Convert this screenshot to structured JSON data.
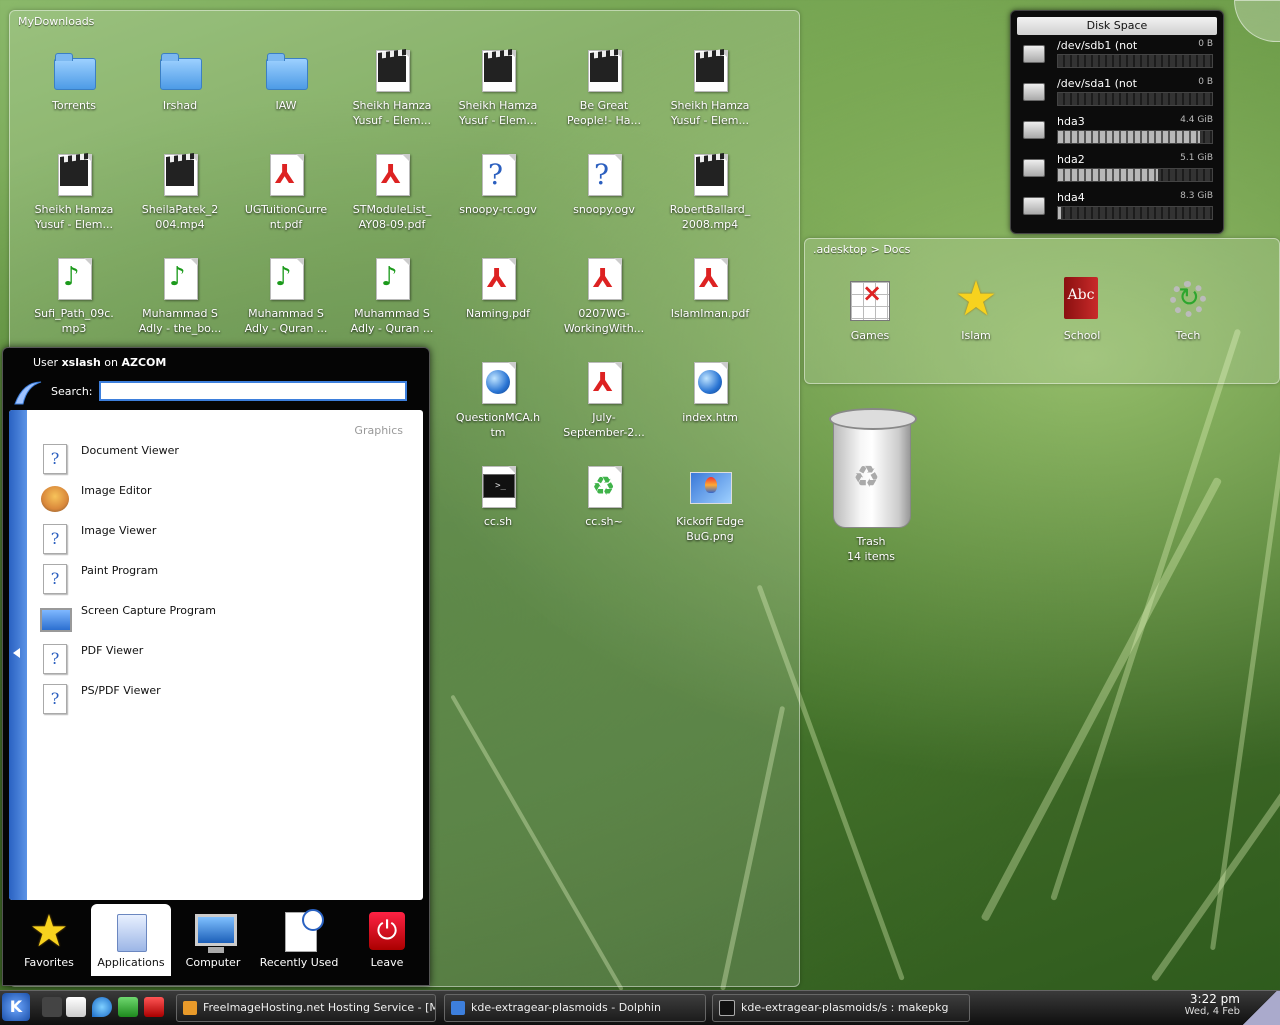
{
  "folder_view": {
    "title": "MyDownloads",
    "items": [
      {
        "label": "Torrents",
        "icon": "folder-icon"
      },
      {
        "label": "Irshad",
        "icon": "folder-icon"
      },
      {
        "label": "IAW",
        "icon": "folder-icon"
      },
      {
        "label": "Sheikh Hamza\nYusuf - Elem...",
        "icon": "video-icon"
      },
      {
        "label": "Sheikh Hamza\nYusuf - Elem...",
        "icon": "video-icon"
      },
      {
        "label": "Be Great\nPeople!- Ha...",
        "icon": "video-icon"
      },
      {
        "label": "Sheikh Hamza\nYusuf - Elem...",
        "icon": "video-icon"
      },
      {
        "label": "Sheikh Hamza\nYusuf - Elem...",
        "icon": "video-icon"
      },
      {
        "label": "SheilaPatek_2\n004.mp4",
        "icon": "video-icon"
      },
      {
        "label": "UGTuitionCurre\nnt.pdf",
        "icon": "pdf-icon"
      },
      {
        "label": "STModuleList_\nAY08-09.pdf",
        "icon": "pdf-icon"
      },
      {
        "label": "snoopy-rc.ogv",
        "icon": "unknown-file-icon"
      },
      {
        "label": "snoopy.ogv",
        "icon": "unknown-file-icon"
      },
      {
        "label": "RobertBallard_\n2008.mp4",
        "icon": "video-icon"
      },
      {
        "label": "Sufi_Path_09c.\nmp3",
        "icon": "audio-icon"
      },
      {
        "label": "Muhammad S\nAdly - the_bo...",
        "icon": "audio-icon"
      },
      {
        "label": "Muhammad S\nAdly - Quran ...",
        "icon": "audio-icon"
      },
      {
        "label": "Muhammad S\nAdly - Quran ...",
        "icon": "audio-icon"
      },
      {
        "label": "Naming.pdf",
        "icon": "pdf-icon"
      },
      {
        "label": "0207WG-\nWorkingWith...",
        "icon": "pdf-icon"
      },
      {
        "label": "IslamIman.pdf",
        "icon": "pdf-icon"
      },
      {
        "label": "QuestionMCA.h\ntm",
        "icon": "html-icon"
      },
      {
        "label": "July-\nSeptember-2...",
        "icon": "pdf-icon"
      },
      {
        "label": "index.htm",
        "icon": "html-icon"
      },
      {
        "label": "cc.sh",
        "icon": "terminal-icon"
      },
      {
        "label": "cc.sh~",
        "icon": "recycle-icon"
      },
      {
        "label": "Kickoff Edge\nBuG.png",
        "icon": "image-icon"
      }
    ]
  },
  "disk_space": {
    "title": "Disk Space",
    "drives": [
      {
        "name": "/dev/sdb1 (not",
        "size": "0 B",
        "used": 0.0
      },
      {
        "name": "/dev/sda1 (not",
        "size": "0 B",
        "used": 0.0
      },
      {
        "name": "hda3",
        "size": "4.4 GiB",
        "used": 0.92
      },
      {
        "name": "hda2",
        "size": "5.1 GiB",
        "used": 0.65
      },
      {
        "name": "hda4",
        "size": "8.3 GiB",
        "used": 0.02
      }
    ]
  },
  "docs_view": {
    "title": ".adesktop > Docs",
    "items": [
      {
        "label": "Games"
      },
      {
        "label": "Islam"
      },
      {
        "label": "School"
      },
      {
        "label": "Tech"
      }
    ]
  },
  "trash": {
    "label": "Trash",
    "count": "14 items"
  },
  "kickoff": {
    "user_prefix": "User",
    "user": "xslash",
    "on": "on",
    "host": "AZCOM",
    "search_label": "Search:",
    "search_value": "",
    "category": "Graphics",
    "items": [
      {
        "label": "Document Viewer",
        "icon": "document-viewer-icon"
      },
      {
        "label": "Image Editor",
        "icon": "gimp-icon"
      },
      {
        "label": "Image Viewer",
        "icon": "image-viewer-icon"
      },
      {
        "label": "Paint Program",
        "icon": "paint-icon"
      },
      {
        "label": "Screen Capture Program",
        "icon": "screen-capture-icon"
      },
      {
        "label": "PDF Viewer",
        "icon": "pdf-viewer-icon"
      },
      {
        "label": "PS/PDF Viewer",
        "icon": "ps-pdf-viewer-icon"
      }
    ],
    "tabs": [
      {
        "label": "Favorites"
      },
      {
        "label": "Applications"
      },
      {
        "label": "Computer"
      },
      {
        "label": "Recently Used"
      },
      {
        "label": "Leave"
      }
    ]
  },
  "taskbar": {
    "start": "K",
    "tasks": [
      {
        "label": "FreeImageHosting.net Hosting Service - [M"
      },
      {
        "label": "kde-extragear-plasmoids - Dolphin"
      },
      {
        "label": "kde-extragear-plasmoids/s : makepkg"
      }
    ],
    "time": "3:22 pm",
    "date": "Wed, 4 Feb"
  },
  "colors": {
    "accent": "#3d7fdc",
    "pdf": "#d22222",
    "audio": "#1b9a1b"
  }
}
